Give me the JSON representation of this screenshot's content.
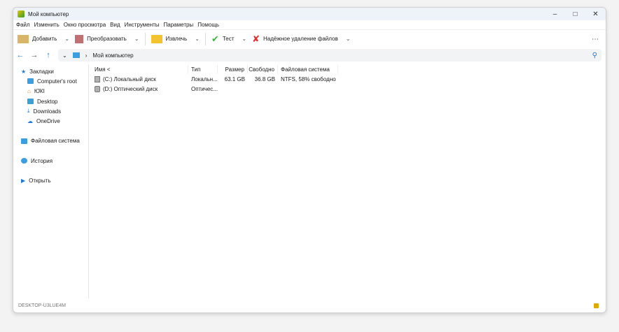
{
  "window": {
    "title": "Мой компьютер",
    "controls": [
      "minimize",
      "maximize",
      "close"
    ]
  },
  "menu": [
    "Файл",
    "Изменить",
    "Окно просмотра",
    "Вид",
    "Инструменты",
    "Параметры",
    "Помощь"
  ],
  "toolbar": [
    {
      "label": "Добавить",
      "icon": "archive-box-icon",
      "color": "#d9b56a"
    },
    {
      "label": "Преобразовать",
      "icon": "convert-icon",
      "color": "#c07070"
    },
    {
      "label": "Извлечь",
      "icon": "folder-extract-icon",
      "color": "#f2c230"
    },
    {
      "label": "Тест",
      "icon": "check-icon",
      "color": "#3cb33c"
    },
    {
      "label": "Надёжное удаление файлов",
      "icon": "x-icon",
      "color": "#e03030"
    }
  ],
  "address": {
    "path": "Мой компьютер"
  },
  "sidebar": {
    "bookmarks": "Закладки",
    "items": [
      "Computer's root",
      "Ю̈КІ",
      "Desktop",
      "Downloads",
      "OneDrive"
    ],
    "filesystem": "Файловая система",
    "history": "История",
    "open": "Открыть"
  },
  "table": {
    "headers": [
      "Имя <",
      "Тип",
      "Размер",
      "Свободно",
      "Файловая система"
    ],
    "rows": [
      [
        "(C:) Локальный диск",
        "Локальн...",
        "63.1 GB",
        "36.8 GB",
        "NTFS, 58% свободно"
      ],
      [
        "(D:) Оптический диск",
        "Оптичес...",
        "",
        "",
        ""
      ]
    ]
  },
  "status": {
    "computer": "DESKTOP-U3LUE4M"
  }
}
